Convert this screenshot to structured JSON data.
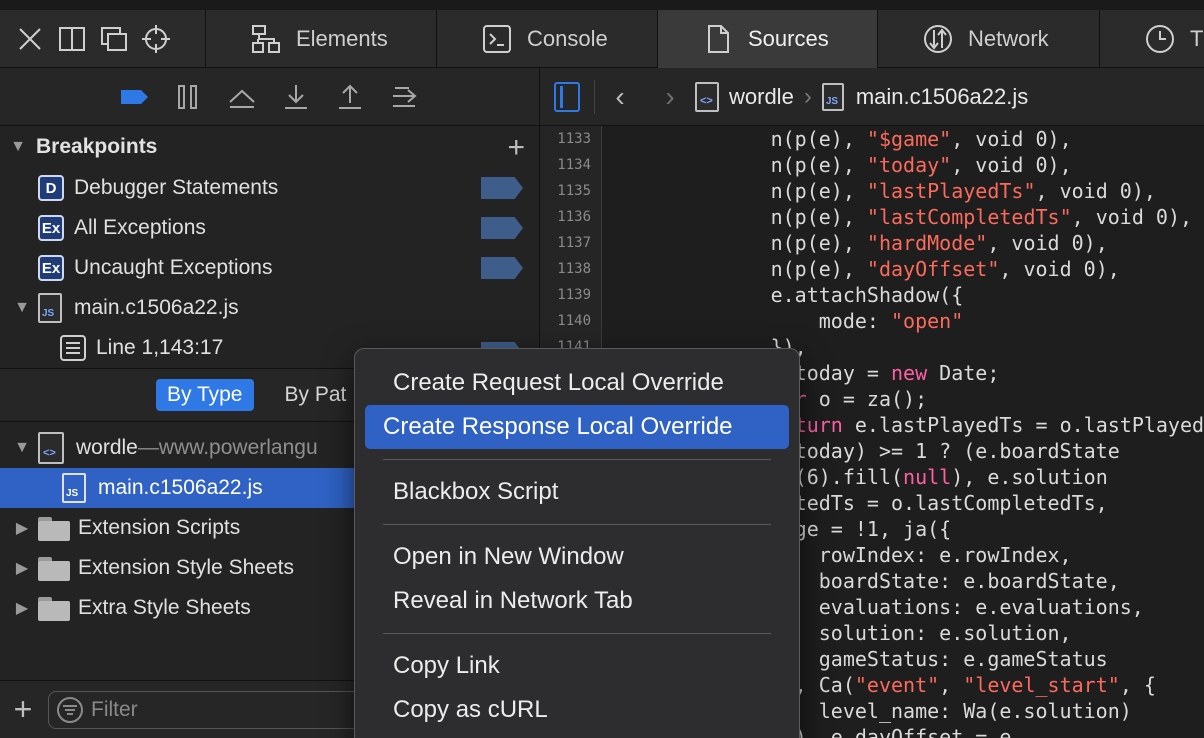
{
  "tabs": [
    {
      "label": "Elements"
    },
    {
      "label": "Console"
    },
    {
      "label": "Sources"
    },
    {
      "label": "Network"
    },
    {
      "label": "T"
    }
  ],
  "navigator": {
    "breakpoints_title": "Breakpoints",
    "breakpoints": [
      {
        "badge": "D",
        "label": "Debugger Statements"
      },
      {
        "badge": "Ex",
        "label": "All Exceptions"
      },
      {
        "badge": "Ex",
        "label": "Uncaught Exceptions"
      }
    ],
    "file_label": "main.c1506a22.js",
    "line_label": "Line 1,143:17",
    "filter_tabs": [
      "By Type",
      "By Pat"
    ],
    "tree": {
      "resource": "wordle",
      "resource_dash": " — ",
      "resource_host": "www.powerlangu",
      "file": "main.c1506a22.js",
      "folders": [
        "Extension Scripts",
        "Extension Style Sheets",
        "Extra Style Sheets"
      ]
    },
    "filter_placeholder": "Filter"
  },
  "content": {
    "crumb_resource": "wordle",
    "crumb_file": "main.c1506a22.js",
    "line_numbers": [
      "1133",
      "1134",
      "1135",
      "1136",
      "1137",
      "1138",
      "1139",
      "1140",
      "1141"
    ]
  },
  "context_menu": {
    "items": [
      "Create Request Local Override",
      "Create Response Local Override",
      "Blackbox Script",
      "Open in New Window",
      "Reveal in Network Tab",
      "Copy Link",
      "Copy as cURL"
    ]
  }
}
